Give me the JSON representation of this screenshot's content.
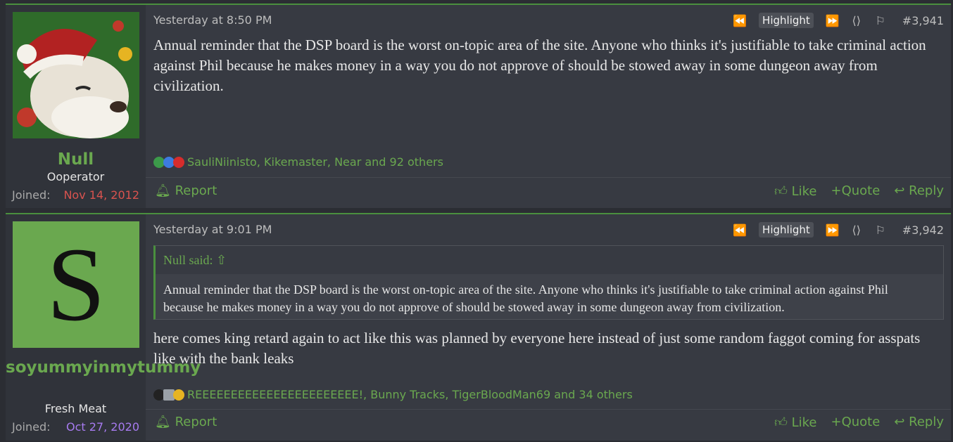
{
  "posts": [
    {
      "username": "Null",
      "user_title": "Ooperator",
      "joined_label": "Joined:",
      "joined_date": "Nov 14, 2012",
      "joined_color": "#d9534f",
      "date": "Yesterday at 8:50 PM",
      "highlight_label": "Highlight",
      "post_number": "#3,941",
      "body": "Annual reminder that the DSP board is the worst on-topic area of the site. Anyone who thinks it's justifiable to take criminal action against Phil because he makes money in a way you do not approve of should be stowed away in some dungeon away from civilization.",
      "reactions": "SauliNiinisto, Kikemaster, Near and 92 others",
      "report_label": "Report",
      "like_label": "Like",
      "quote_label": "+Quote",
      "reply_label": "Reply"
    },
    {
      "username": "soyummyinmytummy",
      "avatar_letter": "S",
      "user_title": "Fresh Meat",
      "joined_label": "Joined:",
      "joined_date": "Oct 27, 2020",
      "joined_color": "#a77bf0",
      "date": "Yesterday at 9:01 PM",
      "highlight_label": "Highlight",
      "post_number": "#3,942",
      "quote_author": "Null said:",
      "quote_body": "Annual reminder that the DSP board is the worst on-topic area of the site. Anyone who thinks it's justifiable to take criminal action against Phil because he makes money in a way you do not approve of should be stowed away in some dungeon away from civilization.",
      "body": "here comes king retard again to act like this was planned by everyone here instead of just some random faggot coming for asspats like with the bank leaks",
      "reactions": "REEEEEEEEEEEEEEEEEEEEEEE!, Bunny Tracks, TigerBloodMan69 and 34 others",
      "report_label": "Report",
      "like_label": "Like",
      "quote_label": "+Quote",
      "reply_label": "Reply"
    }
  ]
}
